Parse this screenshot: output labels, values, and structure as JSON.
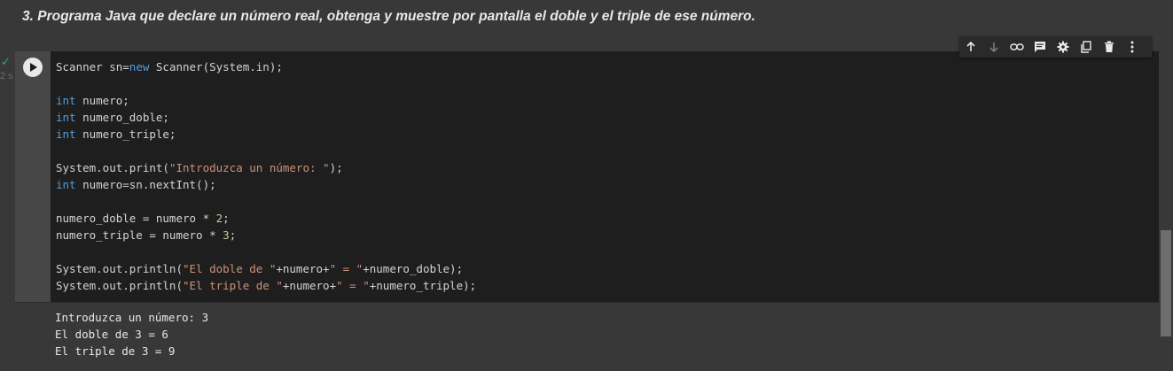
{
  "heading": "3. Programa Java que declare un número real, obtenga y muestre por pantalla el doble y el triple de ese número.",
  "cell": {
    "exec_status": "✓",
    "exec_time": "2 s",
    "code": [
      [
        {
          "t": "Scanner sn="
        },
        {
          "t": "new",
          "c": "kw"
        },
        {
          "t": " Scanner(System.in);"
        }
      ],
      [],
      [
        {
          "t": "int",
          "c": "kw"
        },
        {
          "t": " numero;"
        }
      ],
      [
        {
          "t": "int",
          "c": "kw"
        },
        {
          "t": " numero_doble;"
        }
      ],
      [
        {
          "t": "int",
          "c": "kw"
        },
        {
          "t": " numero_triple;"
        }
      ],
      [],
      [
        {
          "t": "System.out.print("
        },
        {
          "t": "\"Introduzca un número: \"",
          "c": "str"
        },
        {
          "t": ");"
        }
      ],
      [
        {
          "t": "int",
          "c": "kw"
        },
        {
          "t": " numero=sn.nextInt();"
        }
      ],
      [],
      [
        {
          "t": "numero_doble = numero * "
        },
        {
          "t": "2",
          "c": "num"
        },
        {
          "t": ";"
        }
      ],
      [
        {
          "t": "numero_triple = numero * "
        },
        {
          "t": "3",
          "c": "num"
        },
        {
          "t": ";"
        }
      ],
      [],
      [
        {
          "t": "System.out.println("
        },
        {
          "t": "\"El doble de \"",
          "c": "str"
        },
        {
          "t": "+numero+"
        },
        {
          "t": "\" = \"",
          "c": "str"
        },
        {
          "t": "+numero_doble);"
        }
      ],
      [
        {
          "t": "System.out.println("
        },
        {
          "t": "\"El triple de \"",
          "c": "str"
        },
        {
          "t": "+numero+"
        },
        {
          "t": "\" = \"",
          "c": "str"
        },
        {
          "t": "+numero_triple);"
        }
      ]
    ],
    "output": [
      "Introduzca un número: 3",
      "El doble de 3 = 6",
      "El triple de 3 = 9"
    ]
  },
  "toolbar": {
    "icons": [
      "arrow-up-icon",
      "arrow-down-icon",
      "link-icon",
      "comment-icon",
      "gear-icon",
      "mirror-cell-icon",
      "trash-icon",
      "more-vert-icon"
    ]
  }
}
